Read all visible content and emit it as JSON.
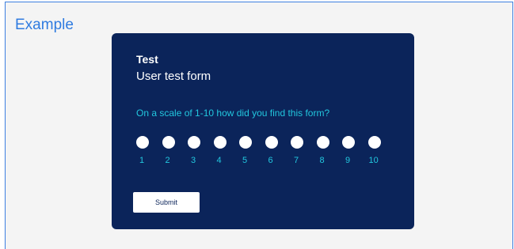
{
  "frame": {
    "title": "Example"
  },
  "form": {
    "title": "Test",
    "subtitle": "User test form",
    "question": "On a scale of 1-10 how did you find this form?",
    "scale": [
      "1",
      "2",
      "3",
      "4",
      "5",
      "6",
      "7",
      "8",
      "9",
      "10"
    ],
    "submit_label": "Submit"
  },
  "colors": {
    "frame_border": "#3d7fe0",
    "frame_background": "#f4f4f4",
    "card_background": "#0b245a",
    "accent_text": "#22c7de",
    "title_link": "#2f7be0"
  }
}
